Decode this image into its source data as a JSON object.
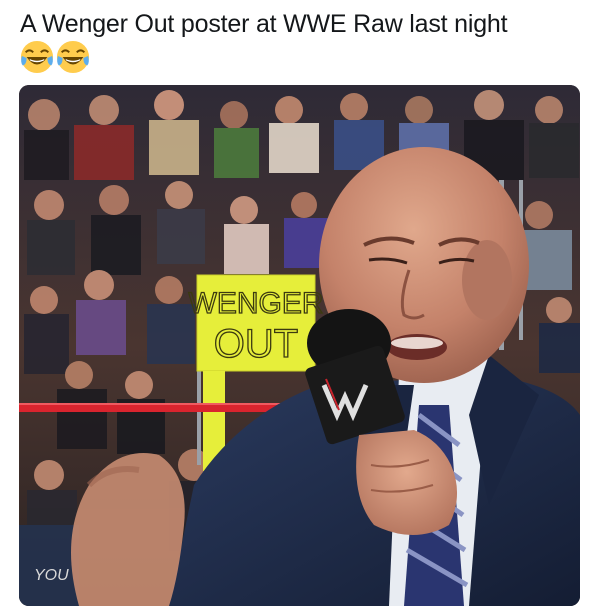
{
  "tweet": {
    "text": "A Wenger Out poster at WWE Raw last night",
    "emojis": [
      "face-with-tears-of-joy",
      "face-with-tears-of-joy"
    ]
  },
  "media": {
    "sign_line1": "WENGER",
    "sign_line2": "OUT",
    "shirt_text": "YOU",
    "colors": {
      "sign": "#e6ee3a",
      "rope": "#d9242e",
      "suit": "#1d2a46",
      "skin": "#c98a6e",
      "crowd": "#3b2d2b",
      "mic": "#1a1a1a"
    }
  }
}
